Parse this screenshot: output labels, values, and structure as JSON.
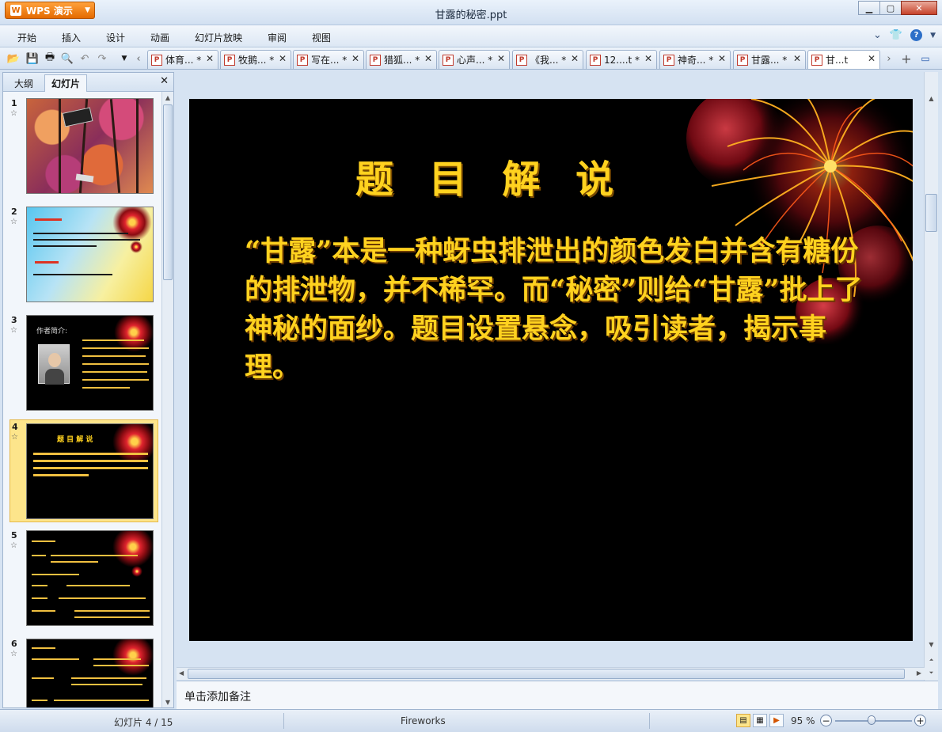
{
  "app": {
    "logo_label": "WPS 演示",
    "window_title": "甘露的秘密.ppt"
  },
  "menu": [
    "开始",
    "插入",
    "设计",
    "动画",
    "幻灯片放映",
    "审阅",
    "视图"
  ],
  "tabs": [
    {
      "label": "体育... *"
    },
    {
      "label": "牧鹅... *"
    },
    {
      "label": "写在... *"
    },
    {
      "label": "猎狐... *"
    },
    {
      "label": "心声... *"
    },
    {
      "label": "《我... *"
    },
    {
      "label": "12....t *"
    },
    {
      "label": "神奇... *"
    },
    {
      "label": "甘露... *"
    },
    {
      "label": "甘...t"
    }
  ],
  "panel": {
    "tab_outline": "大纲",
    "tab_slides": "幻灯片"
  },
  "thumbnails": [
    {
      "num": "1"
    },
    {
      "num": "2"
    },
    {
      "num": "3"
    },
    {
      "num": "4"
    },
    {
      "num": "5"
    },
    {
      "num": "6"
    }
  ],
  "thumb_texts": {
    "t3_label": "作者简介:",
    "t4_title": "题 目 解 说"
  },
  "slide": {
    "title": "题 目 解 说",
    "body": "“甘露”本是一种蚜虫排泄出的颜色发白并含有糖份的排泄物，并不稀罕。而“秘密”则给“甘露”批上了神秘的面纱。题目设置悬念，吸引读者，揭示事理。"
  },
  "notes": {
    "placeholder": "单击添加备注"
  },
  "status": {
    "slide_indicator": "幻灯片 4 / 15",
    "theme": "Fireworks",
    "zoom": "95 %",
    "zoom_level": 0.47
  },
  "colors": {
    "slide_text": "#ffd21f",
    "accent_orange": "#e46a00",
    "selected_thumb": "#fde58b"
  }
}
